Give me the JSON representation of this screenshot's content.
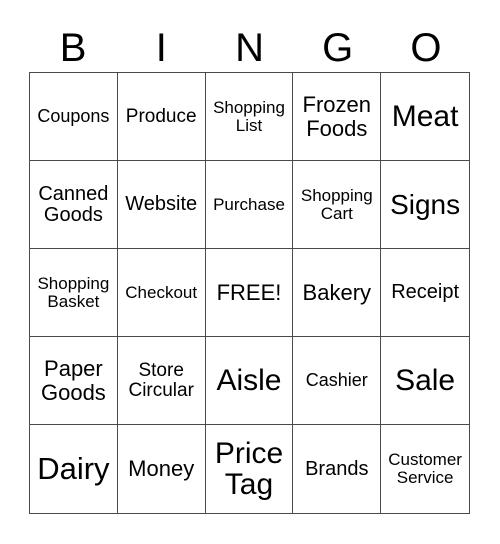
{
  "header": {
    "letters": [
      "B",
      "I",
      "N",
      "G",
      "O"
    ]
  },
  "grid": {
    "rows": [
      [
        "Coupons",
        "Produce",
        "Shopping List",
        "Frozen Foods",
        "Meat"
      ],
      [
        "Canned Goods",
        "Website",
        "Purchase",
        "Shopping Cart",
        "Signs"
      ],
      [
        "Shopping Basket",
        "Checkout",
        "FREE!",
        "Bakery",
        "Receipt"
      ],
      [
        "Paper Goods",
        "Store Circular",
        "Aisle",
        "Cashier",
        "Sale"
      ],
      [
        "Dairy",
        "Money",
        "Price Tag",
        "Brands",
        "Customer Service"
      ]
    ]
  }
}
